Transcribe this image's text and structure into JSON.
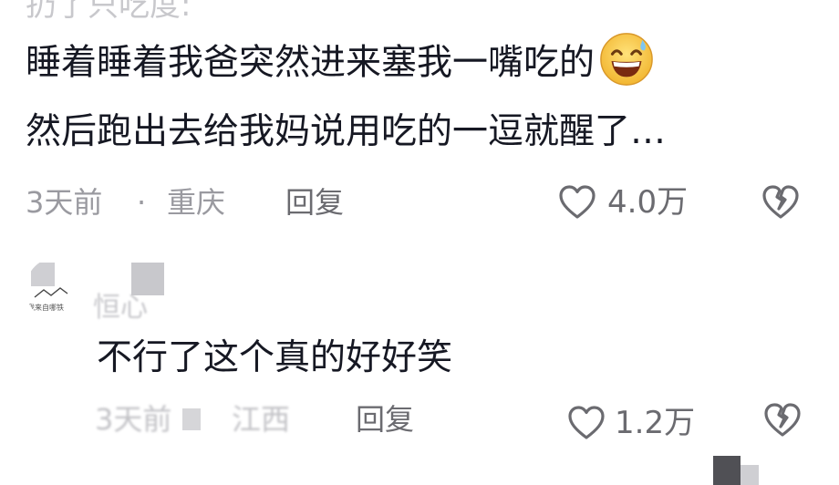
{
  "cutoff_text": "扔了只吃度:",
  "comment1": {
    "line1": "睡着睡着我爸突然进来塞我一嘴吃的",
    "line2": "然后跑出去给我妈说用吃的一逗就醒了…",
    "emoji": "grinning-sweat-emoji",
    "time": "3天前",
    "dot": "·",
    "location": "重庆",
    "reply_label": "回复",
    "like_count": "4.0万"
  },
  "comment2": {
    "username": "恒心",
    "avatar_watermark": "我来自哪铁",
    "text": "不行了这个真的好好笑",
    "time": "3天前",
    "location": "江西",
    "reply_label": "回复",
    "like_count": "1.2万"
  },
  "colors": {
    "text_primary": "#161823",
    "text_secondary": "#9a9aa0",
    "action_gray": "#6b6b70"
  }
}
